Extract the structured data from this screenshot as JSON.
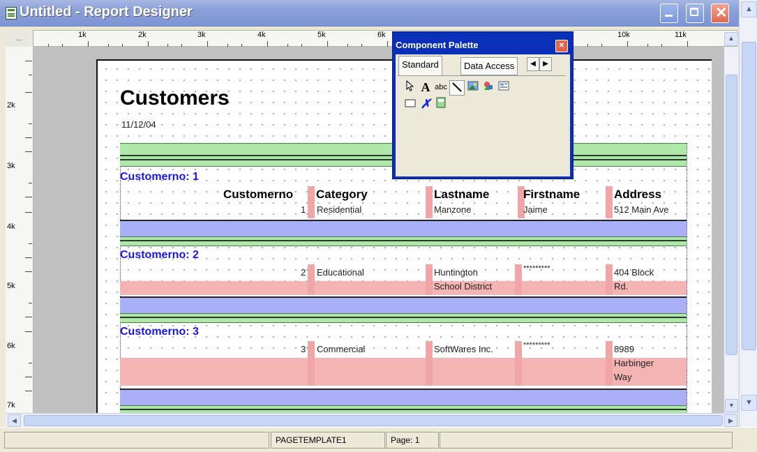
{
  "window": {
    "title": "Untitled - Report Designer",
    "close_glyph": "✕"
  },
  "ruler": {
    "corner": "...",
    "top_labels": [
      "1k",
      "2k",
      "3k",
      "4k",
      "5k",
      "6k",
      "10k",
      "11k"
    ],
    "left_labels": [
      "2k",
      "3k",
      "4k",
      "5k",
      "6k",
      "7k"
    ]
  },
  "report": {
    "title": "Customers",
    "date": "11/12/04",
    "headers": {
      "customerno": "Customerno",
      "category": "Category",
      "lastname": "Lastname",
      "firstname": "Firstname",
      "address": "Address"
    },
    "groups": [
      {
        "label": "Customerno: 1",
        "row": {
          "customerno": "1",
          "category": "Residential",
          "lastname": "Manzone",
          "firstname": "Jaime",
          "address": "512 Main Ave"
        }
      },
      {
        "label": "Customerno: 2",
        "row": {
          "customerno": "2",
          "category": "Educational",
          "lastname_1": "Huntington",
          "lastname_2": "School District",
          "firstname": "*********",
          "address_1": "404 Block",
          "address_2": "Rd."
        }
      },
      {
        "label": "Customerno: 3",
        "row": {
          "customerno": "3",
          "category": "Commercial",
          "lastname": "SoftWares Inc.",
          "firstname": "*********",
          "address_1": "8989",
          "address_2": "Harbinger",
          "address_3": "Way"
        }
      }
    ]
  },
  "palette": {
    "title": "Component Palette",
    "tabs": [
      "Standard",
      "Data Access"
    ],
    "active_tab": "Standard",
    "icons": [
      "pointer-icon",
      "text-icon",
      "label-icon",
      "line-icon",
      "image-icon",
      "shape-icon",
      "memo-icon",
      "rectangle-icon",
      "checkbox-icon",
      "richtext-icon"
    ]
  },
  "statusbar": {
    "template": "PAGETEMPLATE1",
    "page": "Page: 1"
  },
  "colors": {
    "group_header_bg": "#aee8a8",
    "detail_bg": "#f5b4b4",
    "footer_bg": "#aab0f8",
    "group_text": "#1a14e6",
    "palette_frame": "#0a2fb8"
  }
}
